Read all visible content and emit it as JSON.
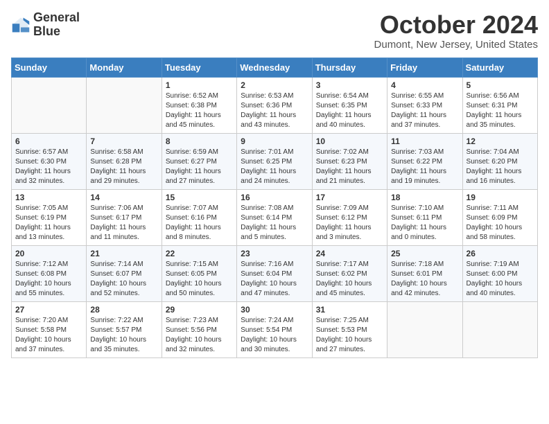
{
  "logo": {
    "line1": "General",
    "line2": "Blue"
  },
  "title": "October 2024",
  "location": "Dumont, New Jersey, United States",
  "weekdays": [
    "Sunday",
    "Monday",
    "Tuesday",
    "Wednesday",
    "Thursday",
    "Friday",
    "Saturday"
  ],
  "weeks": [
    [
      {
        "day": "",
        "info": ""
      },
      {
        "day": "",
        "info": ""
      },
      {
        "day": "1",
        "info": "Sunrise: 6:52 AM\nSunset: 6:38 PM\nDaylight: 11 hours and 45 minutes."
      },
      {
        "day": "2",
        "info": "Sunrise: 6:53 AM\nSunset: 6:36 PM\nDaylight: 11 hours and 43 minutes."
      },
      {
        "day": "3",
        "info": "Sunrise: 6:54 AM\nSunset: 6:35 PM\nDaylight: 11 hours and 40 minutes."
      },
      {
        "day": "4",
        "info": "Sunrise: 6:55 AM\nSunset: 6:33 PM\nDaylight: 11 hours and 37 minutes."
      },
      {
        "day": "5",
        "info": "Sunrise: 6:56 AM\nSunset: 6:31 PM\nDaylight: 11 hours and 35 minutes."
      }
    ],
    [
      {
        "day": "6",
        "info": "Sunrise: 6:57 AM\nSunset: 6:30 PM\nDaylight: 11 hours and 32 minutes."
      },
      {
        "day": "7",
        "info": "Sunrise: 6:58 AM\nSunset: 6:28 PM\nDaylight: 11 hours and 29 minutes."
      },
      {
        "day": "8",
        "info": "Sunrise: 6:59 AM\nSunset: 6:27 PM\nDaylight: 11 hours and 27 minutes."
      },
      {
        "day": "9",
        "info": "Sunrise: 7:01 AM\nSunset: 6:25 PM\nDaylight: 11 hours and 24 minutes."
      },
      {
        "day": "10",
        "info": "Sunrise: 7:02 AM\nSunset: 6:23 PM\nDaylight: 11 hours and 21 minutes."
      },
      {
        "day": "11",
        "info": "Sunrise: 7:03 AM\nSunset: 6:22 PM\nDaylight: 11 hours and 19 minutes."
      },
      {
        "day": "12",
        "info": "Sunrise: 7:04 AM\nSunset: 6:20 PM\nDaylight: 11 hours and 16 minutes."
      }
    ],
    [
      {
        "day": "13",
        "info": "Sunrise: 7:05 AM\nSunset: 6:19 PM\nDaylight: 11 hours and 13 minutes."
      },
      {
        "day": "14",
        "info": "Sunrise: 7:06 AM\nSunset: 6:17 PM\nDaylight: 11 hours and 11 minutes."
      },
      {
        "day": "15",
        "info": "Sunrise: 7:07 AM\nSunset: 6:16 PM\nDaylight: 11 hours and 8 minutes."
      },
      {
        "day": "16",
        "info": "Sunrise: 7:08 AM\nSunset: 6:14 PM\nDaylight: 11 hours and 5 minutes."
      },
      {
        "day": "17",
        "info": "Sunrise: 7:09 AM\nSunset: 6:12 PM\nDaylight: 11 hours and 3 minutes."
      },
      {
        "day": "18",
        "info": "Sunrise: 7:10 AM\nSunset: 6:11 PM\nDaylight: 11 hours and 0 minutes."
      },
      {
        "day": "19",
        "info": "Sunrise: 7:11 AM\nSunset: 6:09 PM\nDaylight: 10 hours and 58 minutes."
      }
    ],
    [
      {
        "day": "20",
        "info": "Sunrise: 7:12 AM\nSunset: 6:08 PM\nDaylight: 10 hours and 55 minutes."
      },
      {
        "day": "21",
        "info": "Sunrise: 7:14 AM\nSunset: 6:07 PM\nDaylight: 10 hours and 52 minutes."
      },
      {
        "day": "22",
        "info": "Sunrise: 7:15 AM\nSunset: 6:05 PM\nDaylight: 10 hours and 50 minutes."
      },
      {
        "day": "23",
        "info": "Sunrise: 7:16 AM\nSunset: 6:04 PM\nDaylight: 10 hours and 47 minutes."
      },
      {
        "day": "24",
        "info": "Sunrise: 7:17 AM\nSunset: 6:02 PM\nDaylight: 10 hours and 45 minutes."
      },
      {
        "day": "25",
        "info": "Sunrise: 7:18 AM\nSunset: 6:01 PM\nDaylight: 10 hours and 42 minutes."
      },
      {
        "day": "26",
        "info": "Sunrise: 7:19 AM\nSunset: 6:00 PM\nDaylight: 10 hours and 40 minutes."
      }
    ],
    [
      {
        "day": "27",
        "info": "Sunrise: 7:20 AM\nSunset: 5:58 PM\nDaylight: 10 hours and 37 minutes."
      },
      {
        "day": "28",
        "info": "Sunrise: 7:22 AM\nSunset: 5:57 PM\nDaylight: 10 hours and 35 minutes."
      },
      {
        "day": "29",
        "info": "Sunrise: 7:23 AM\nSunset: 5:56 PM\nDaylight: 10 hours and 32 minutes."
      },
      {
        "day": "30",
        "info": "Sunrise: 7:24 AM\nSunset: 5:54 PM\nDaylight: 10 hours and 30 minutes."
      },
      {
        "day": "31",
        "info": "Sunrise: 7:25 AM\nSunset: 5:53 PM\nDaylight: 10 hours and 27 minutes."
      },
      {
        "day": "",
        "info": ""
      },
      {
        "day": "",
        "info": ""
      }
    ]
  ]
}
